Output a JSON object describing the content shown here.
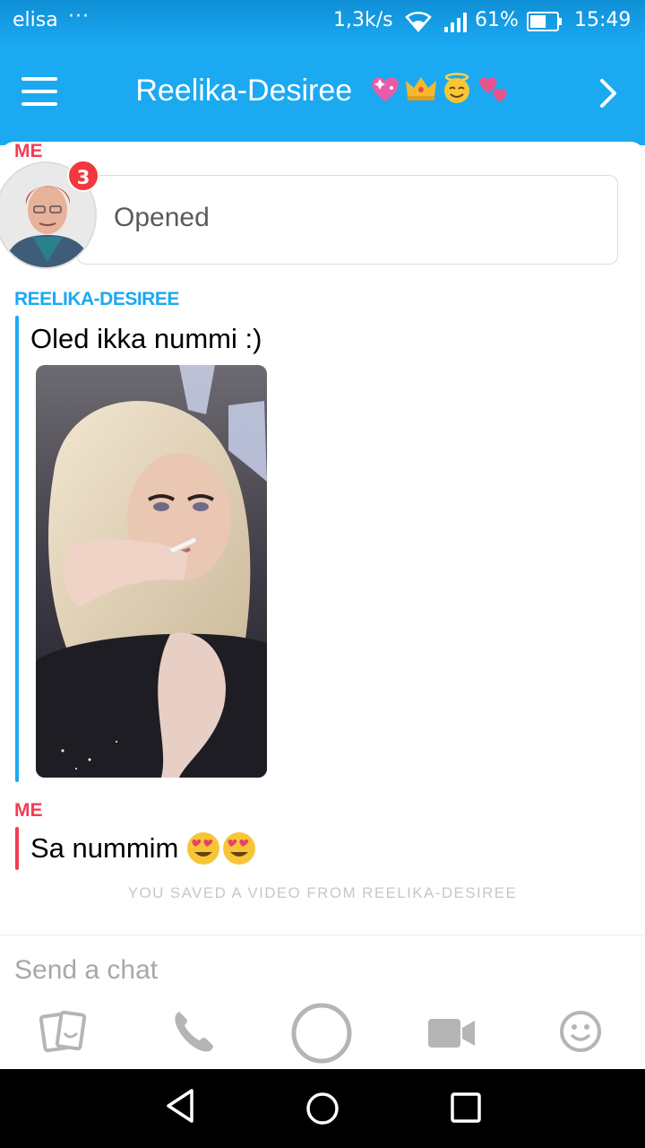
{
  "status_bar": {
    "carrier": "elisa",
    "more": "···",
    "speed": "1,3k/s",
    "battery_percent": "61%",
    "time": "15:49",
    "battery_level": 0.61
  },
  "header": {
    "title": "Reelika-Desiree",
    "title_emojis": [
      "sparkling-heart-icon",
      "crown-icon",
      "smiling-halo-face-icon",
      "two-hearts-icon"
    ]
  },
  "chat": {
    "me_label_1": "ME",
    "unread_count": "3",
    "opened_text": "Opened",
    "friend_label": "REELIKA-DESIREE",
    "friend_message": "Oled ikka nummi :)",
    "me_label_2": "ME",
    "my_message": "Sa nummim",
    "my_message_emojis": [
      "heart-eyes-face-icon",
      "heart-eyes-face-icon"
    ],
    "saved_note": "YOU SAVED A VIDEO FROM REELIKA-DESIREE"
  },
  "composer": {
    "placeholder": "Send a chat"
  },
  "colors": {
    "brand_blue": "#1ba9f2",
    "me_red": "#f23c57",
    "badge_red": "#f2383f",
    "icon_gray": "#b5b5b5"
  }
}
